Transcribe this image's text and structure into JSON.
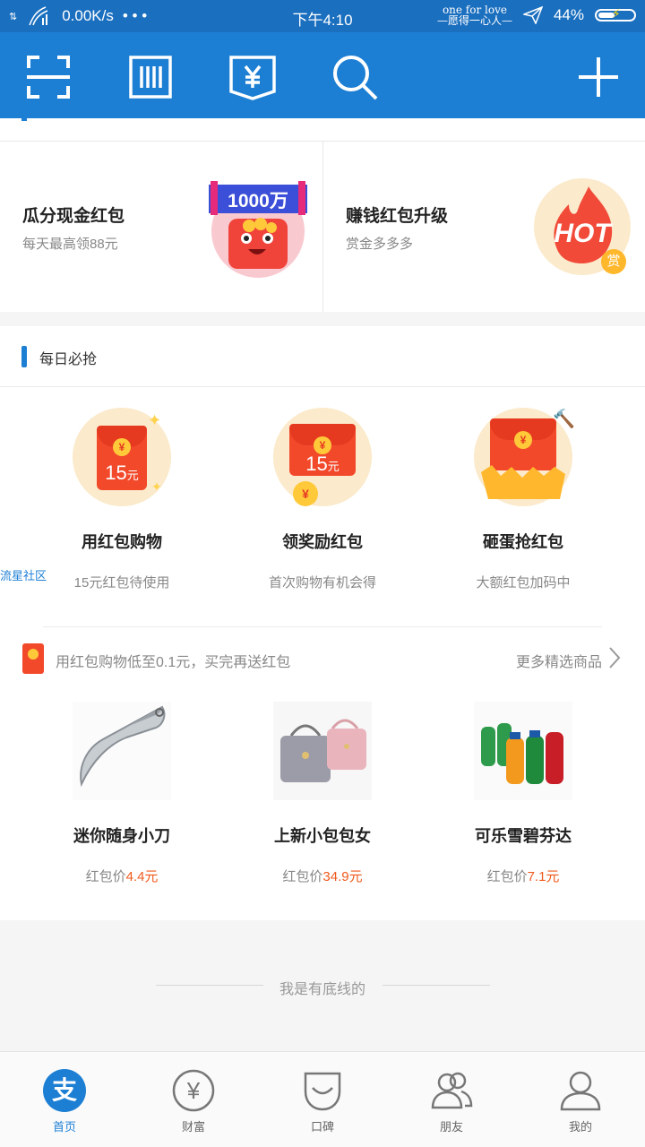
{
  "status_bar": {
    "net_speed": "0.00K/s",
    "dots": "• • •",
    "time": "下午4:10",
    "signature_top": "one for love",
    "signature_bottom": "—愿得一心人—",
    "battery": "44%"
  },
  "toolbar": {
    "icons": [
      "scan-icon",
      "barcode-icon",
      "payment-code-icon",
      "search-icon",
      "add-icon"
    ]
  },
  "promo": {
    "left": {
      "title": "瓜分现金红包",
      "subtitle": "每天最高领88元",
      "badge": "1000万"
    },
    "right": {
      "title": "赚钱红包升级",
      "subtitle": "赏金多多多",
      "badge": "HOT",
      "coin": "赏"
    }
  },
  "daily": {
    "title": "每日必抢",
    "items": [
      {
        "title": "用红包购物",
        "subtitle": "15元红包待使用",
        "amount": "15",
        "unit": "元",
        "coin": "¥"
      },
      {
        "title": "领奖励红包",
        "subtitle": "首次购物有机会得",
        "amount": "15",
        "unit": "元",
        "coin": "¥"
      },
      {
        "title": "砸蛋抢红包",
        "subtitle": "大额红包加码中",
        "coin": "¥"
      }
    ],
    "side_label": "流星社区"
  },
  "shop": {
    "banner_text": "用红包购物低至0.1元，买完再送红包",
    "more_label": "更多精选商品",
    "products": [
      {
        "title": "迷你随身小刀",
        "price_label": "红包价",
        "price": "4.4元"
      },
      {
        "title": "上新小包包女",
        "price_label": "红包价",
        "price": "34.9元"
      },
      {
        "title": "可乐雪碧芬达",
        "price_label": "红包价",
        "price": "7.1元"
      }
    ]
  },
  "footer_text": "我是有底线的",
  "bottom_nav": [
    {
      "label": "首页",
      "icon": "alipay-home-icon",
      "active": true,
      "glyph": "支"
    },
    {
      "label": "财富",
      "icon": "wealth-icon",
      "active": false,
      "glyph": "¥"
    },
    {
      "label": "口碑",
      "icon": "koubei-icon",
      "active": false
    },
    {
      "label": "朋友",
      "icon": "friends-icon",
      "active": false
    },
    {
      "label": "我的",
      "icon": "profile-icon",
      "active": false
    }
  ],
  "colors": {
    "brand_blue": "#1c7fd4",
    "status_blue": "#1b6fbf",
    "red": "#f2492b",
    "price_orange": "#f05a1e"
  }
}
